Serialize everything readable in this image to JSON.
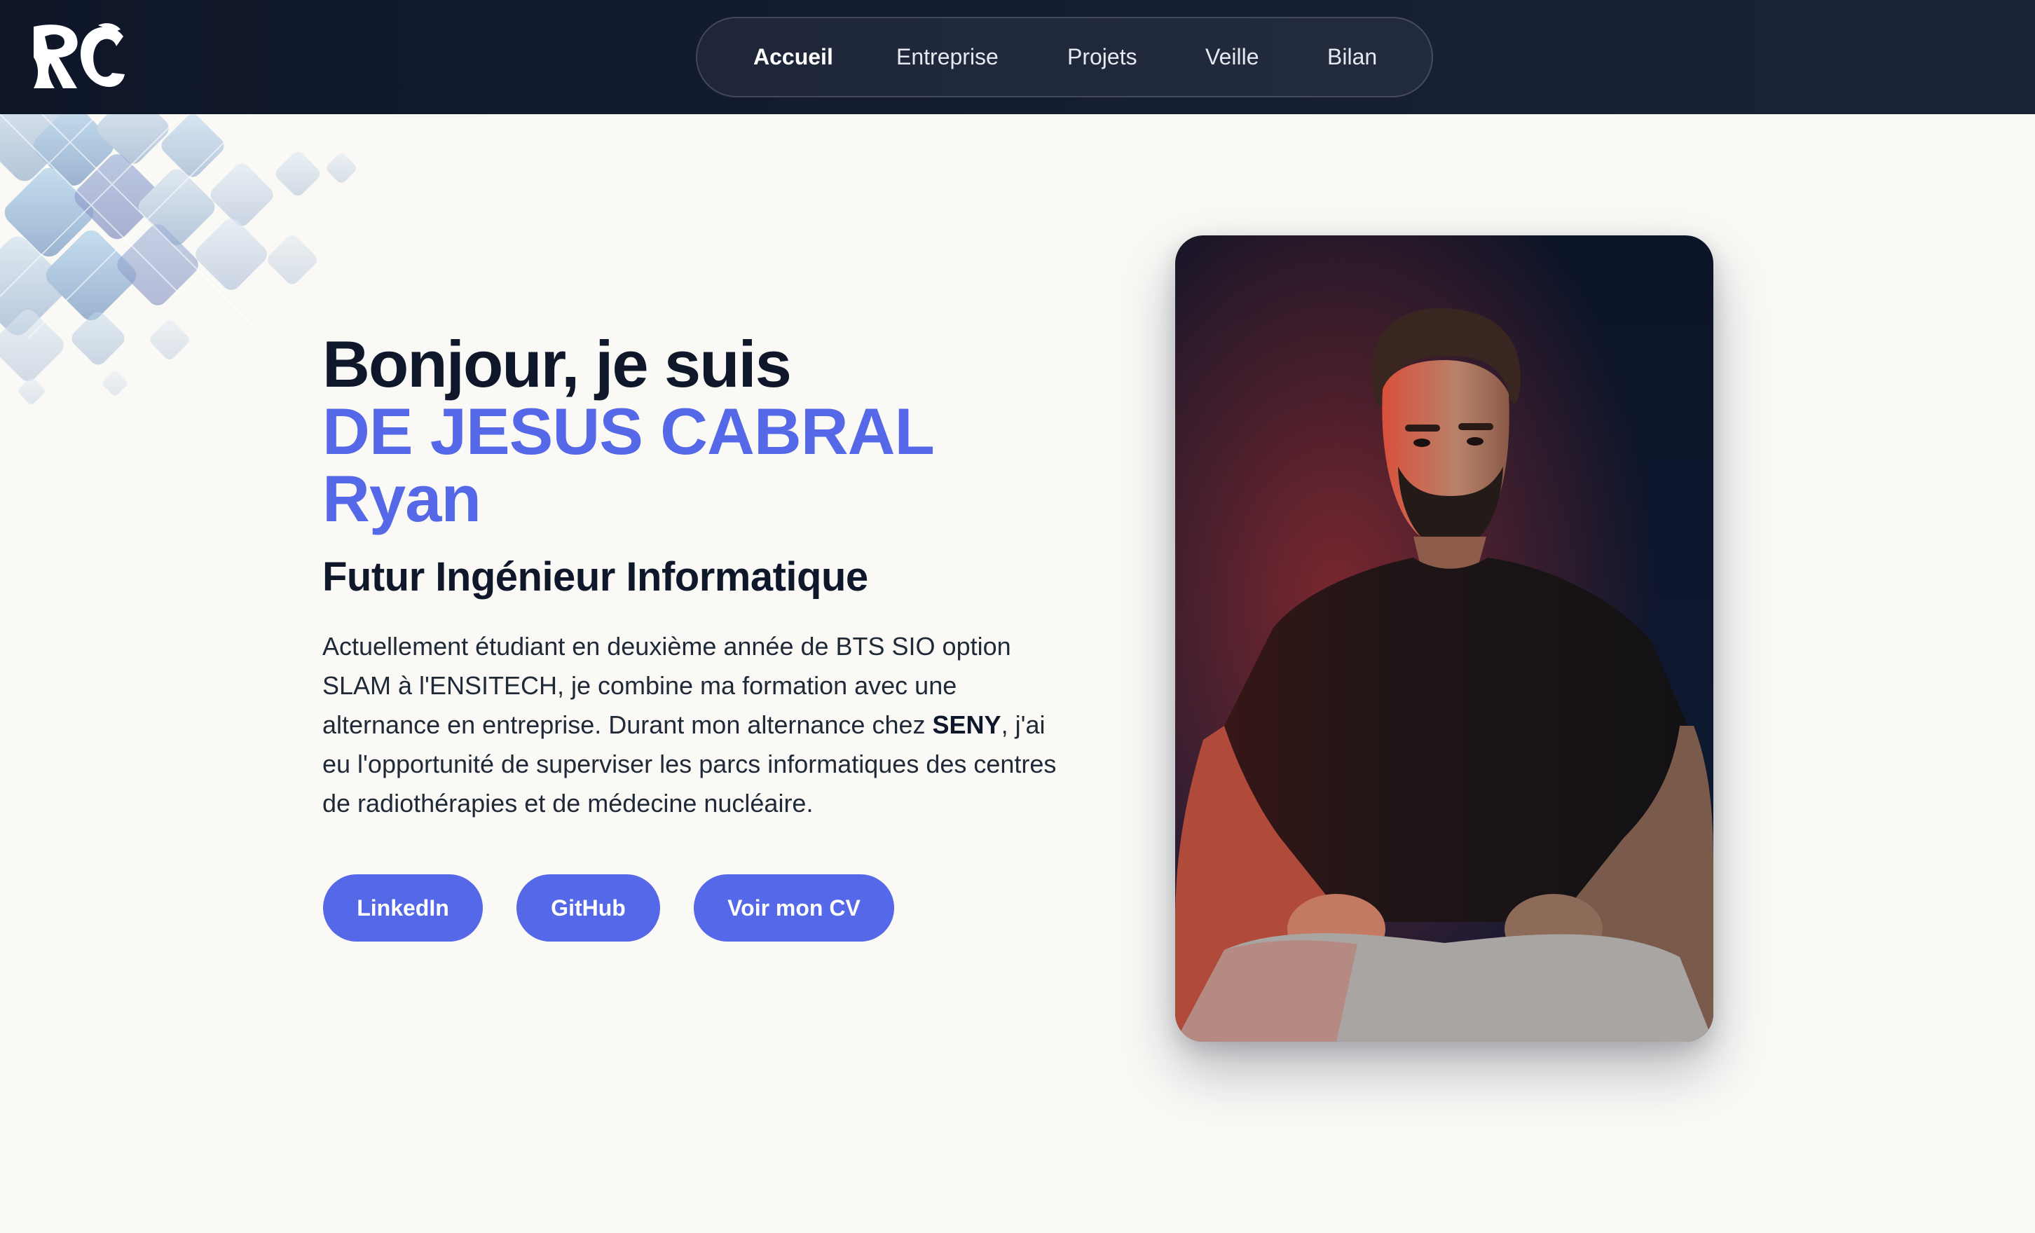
{
  "logo": {
    "icon": "rc-monogram-logo",
    "alt": "RC"
  },
  "nav": {
    "items": [
      {
        "label": "Accueil",
        "active": true
      },
      {
        "label": "Entreprise",
        "active": false
      },
      {
        "label": "Projets",
        "active": false
      },
      {
        "label": "Veille",
        "active": false
      },
      {
        "label": "Bilan",
        "active": false
      }
    ]
  },
  "hero": {
    "greeting": "Bonjour, je suis",
    "name_line1": "DE JESUS CABRAL",
    "name_line2": "Ryan",
    "role": "Futur Ingénieur Informatique",
    "bio_part1": "Actuellement étudiant en deuxième année de BTS SIO option SLAM à l'ENSITECH, je combine ma formation avec une alternance en entreprise. Durant mon alternance chez ",
    "bio_company": "SENY",
    "bio_part2": ", j'ai eu l'opportunité de superviser les parcs informatiques des centres de radiothérapies et de médecine nucléaire.",
    "buttons": {
      "linkedin": "LinkedIn",
      "github": "GitHub",
      "cv": "Voir mon CV"
    }
  },
  "photo": {
    "alt": "Portrait"
  },
  "colors": {
    "accent": "#5468e8",
    "header_bg": "#0e1628",
    "page_bg": "#faf9f6",
    "text_dark": "#0f172a"
  }
}
